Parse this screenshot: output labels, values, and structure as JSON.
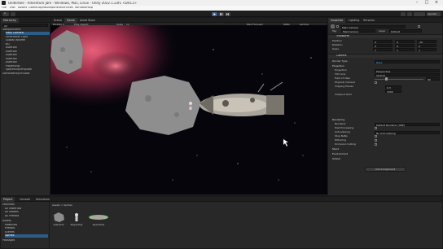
{
  "window": {
    "title": "Undertale - Adventure Jam - Windows, Mac, Linux - Unity 2022.1.23f1 <DX11>",
    "buttons": [
      "–",
      "□",
      "×"
    ]
  },
  "menu": [
    "File",
    "Edit",
    "Assets",
    "GameObject",
    "Component",
    "Services",
    "Window",
    "Help"
  ],
  "toolbar": {
    "account": "A",
    "play_icons": [
      "play-icon",
      "pause-icon",
      "step-icon"
    ],
    "layout": "Layouts"
  },
  "hierarchy": {
    "tab": "Hierarchy",
    "search": "All",
    "scene": "SampleScene",
    "items": [
      "Main Camera",
      "Directional Light",
      "Global Volume",
      "BG",
      "Asteroid",
      "Asteroid",
      "Asteroid",
      "Asteroid",
      "Asteroid",
      "PlayerShip",
      "SpaceshipTemplate"
    ],
    "dont_destroy": "DontDestroyOnLoad"
  },
  "scene_view": {
    "tabs": [
      "Scene",
      "Game",
      "Asset Store"
    ],
    "display": "Display 1",
    "aspect": "Free Aspect",
    "scale_label": "Scale",
    "scale_value": "1x",
    "play_focused": "Play Focused",
    "stats": "Stats",
    "gizmos": "Gizmos"
  },
  "inspector": {
    "tabs": [
      "Inspector",
      "Lighting",
      "Services"
    ],
    "object_name": "Main Camera",
    "tag_label": "Tag",
    "tag": "MainCamera",
    "layer_label": "Layer",
    "layer": "Default",
    "transform": "Transform",
    "pos_label": "Position",
    "rot_label": "Rotation",
    "scale_label": "Scale",
    "pos": [
      "0",
      "0",
      "-10"
    ],
    "rot": [
      "0",
      "0",
      "0"
    ],
    "scale": [
      "1",
      "1",
      "1"
    ],
    "camera": "Camera",
    "render_type_label": "Render Type",
    "render_type": "Base",
    "projection": "Projection",
    "proj_label": "Projection",
    "proj_value": "Perspective",
    "fov_axis_label": "FOV Axis",
    "fov_axis": "Vertical",
    "fov_label": "Field of View",
    "fov": "60",
    "physical": "Physical Camera",
    "clip_label": "Clipping Planes",
    "near": "0.3",
    "far": "1000",
    "viewport_label": "Viewport Rect",
    "rendering": "Rendering",
    "renderer_label": "Renderer",
    "renderer": "Default Renderer (URP)",
    "pp_label": "Post Processing",
    "aa_label": "Anti-aliasing",
    "aa": "No Anti-aliasing",
    "stop_nan_label": "Stop NaNs",
    "dithering_label": "Dithering",
    "occlusion_label": "Occlusion Culling",
    "stack": "Stack",
    "env": "Environment",
    "output": "Output",
    "add_component": "Add Component"
  },
  "project": {
    "tabs": [
      "Project",
      "Console",
      "Animation"
    ],
    "tree": [
      "Favorites",
      "All Materials",
      "All Models",
      "All Prefabs",
      "Assets",
      "Materials",
      "Prefabs",
      "Scenes",
      "Sprites",
      "Packages"
    ],
    "breadcrumb": "Assets > Sprites",
    "assets": [
      "Asteroids",
      "PlayerShip",
      "SpaceShip"
    ]
  },
  "colors": {
    "accent": "#2c5d87",
    "play": "#3c5a8a",
    "title_bg": "#f0f0f0"
  }
}
